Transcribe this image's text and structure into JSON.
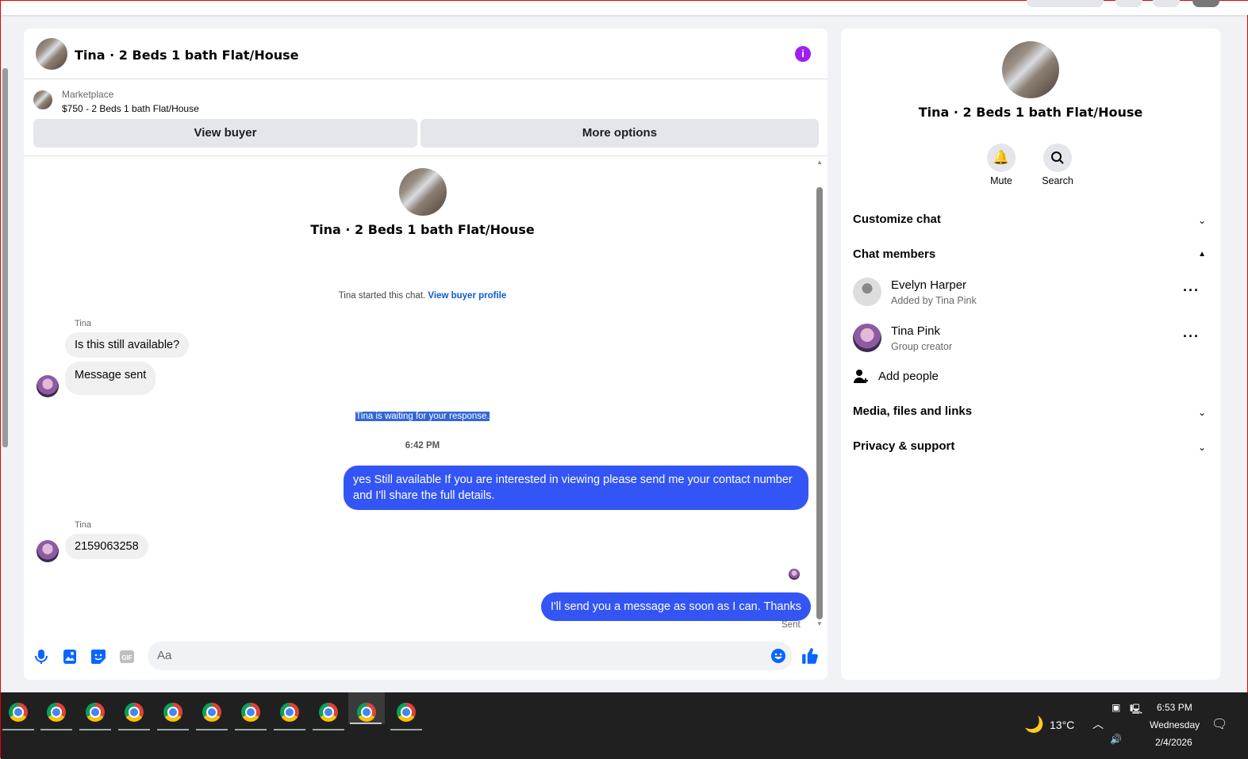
{
  "chat": {
    "title": "Tina · 2 Beds 1 bath Flat/House",
    "info_icon": "i",
    "marketplace_label": "Marketplace",
    "listing": "$750 - 2 Beds 1 bath Flat/House",
    "view_buyer": "View buyer",
    "more_options": "More options",
    "intro_title": "Tina · 2 Beds 1 bath Flat/House",
    "started_text": "Tina started this chat.",
    "view_buyer_profile": "View buyer profile",
    "messages": [
      {
        "sender": "Tina",
        "text": "Is this still available?"
      },
      {
        "text": "Message sent"
      },
      {
        "system": "Tina is waiting for your response."
      },
      {
        "time": "6:42 PM"
      },
      {
        "text": "yes Still available If you are interested in viewing please send me your contact number and I'll share the full details."
      },
      {
        "sender": "Tina",
        "text": "2159063258"
      },
      {
        "text": "I'll send you a message as soon as I can. Thanks",
        "status": "Sent"
      }
    ],
    "input_placeholder": "Aa",
    "accent": "#3455f5"
  },
  "info": {
    "title": "Tina · 2 Beds 1 bath Flat/House",
    "mute": "Mute",
    "search": "Search",
    "customize": "Customize chat",
    "members_header": "Chat members",
    "members": [
      {
        "name": "Evelyn Harper",
        "sub": "Added by Tina Pink"
      },
      {
        "name": "Tina Pink",
        "sub": "Group creator"
      }
    ],
    "add_people": "Add people",
    "media": "Media, files and links",
    "privacy": "Privacy & support"
  },
  "taskbar": {
    "temp": "13°C",
    "time": "6:53 PM",
    "day": "Wednesday",
    "date": "2/4/2026"
  }
}
